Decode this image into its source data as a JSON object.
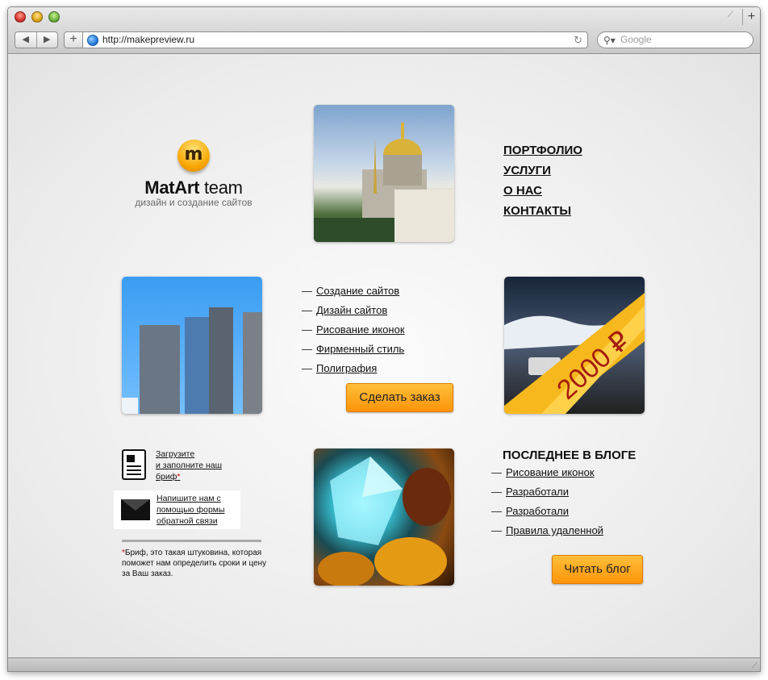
{
  "browser": {
    "url": "http://makepreview.ru",
    "search_placeholder": "Google",
    "back_icon": "◀",
    "forward_icon": "▶",
    "add_icon": "+",
    "newtab_icon": "+"
  },
  "logo": {
    "mark": "m",
    "name_bold": "MatArt",
    "name_rest": " team",
    "tagline": "дизайн и создание сайтов"
  },
  "menu": [
    "Портфолио",
    "Услуги",
    "О нас",
    "Контакты"
  ],
  "services": {
    "items": [
      "Создание сайтов",
      "Дизайн сайтов",
      "Рисование иконок",
      "Фирменный стиль",
      "Полиграфия"
    ],
    "order_button": "Сделать заказ"
  },
  "promo": {
    "price": "2000 ₽"
  },
  "brief": {
    "upload_line1": "Загрузите",
    "upload_line2": "и заполните наш",
    "upload_line3": "бриф",
    "feedback_line1": "Напишите нам с",
    "feedback_line2": "помощью формы",
    "feedback_line3": "обратной связи",
    "footnote": "Бриф, это такая штуковина, которая поможет нам определить сроки и цену за Ваш заказ.",
    "star": "*"
  },
  "blog": {
    "title": "Последнее в блоге",
    "items": [
      "Рисование иконок",
      "Разработали",
      "Разработали",
      "Правила удаленной"
    ],
    "read_button": "Читать блог"
  },
  "colors": {
    "accent": "#fb9409",
    "accent_light": "#ffbf3a"
  }
}
